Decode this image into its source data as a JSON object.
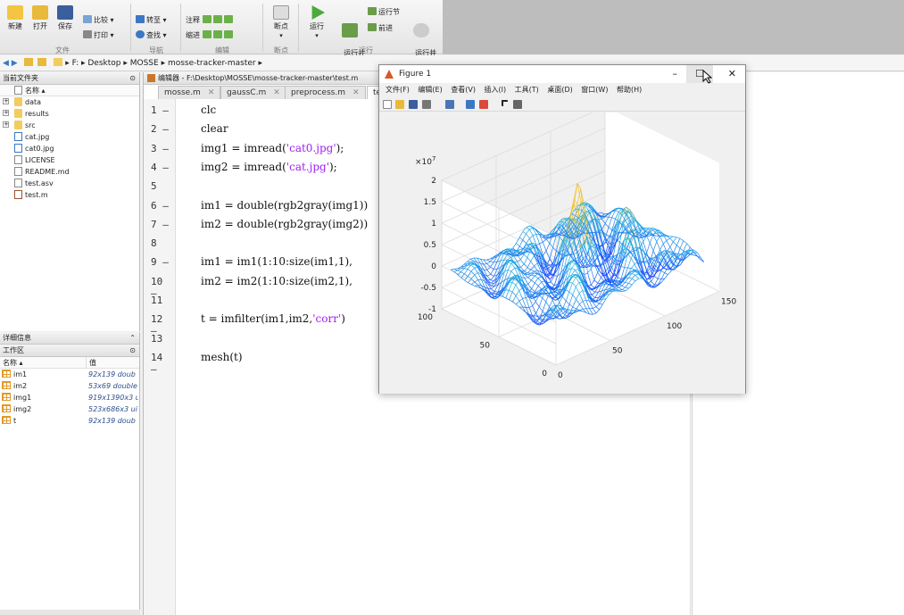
{
  "toolstrip": {
    "buttons": [
      {
        "label": "新建"
      },
      {
        "label": "打开"
      },
      {
        "label": "保存"
      }
    ],
    "file_small": [
      "比较",
      "打印"
    ],
    "nav_small": [
      "转至",
      "查找"
    ],
    "edit_small": [
      "注释",
      "缩进"
    ],
    "breakpoint_label": "断点",
    "run_label": "运行",
    "run_advance_label": "运行并\n前进",
    "run_section_label": "运行节",
    "advance_label": "前进",
    "run_time_label": "运行并\n计时",
    "sections": [
      "文件",
      "导航",
      "编辑",
      "断点",
      "运行"
    ]
  },
  "address": {
    "path": [
      "F:",
      "Desktop",
      "MOSSE",
      "mosse-tracker-master"
    ]
  },
  "current_folder": {
    "title": "当前文件夹",
    "column": "名称 ▴",
    "items": [
      {
        "name": "data",
        "type": "folder"
      },
      {
        "name": "results",
        "type": "folder"
      },
      {
        "name": "src",
        "type": "folder"
      },
      {
        "name": "cat.jpg",
        "type": "img"
      },
      {
        "name": "cat0.jpg",
        "type": "img"
      },
      {
        "name": "LICENSE",
        "type": "file"
      },
      {
        "name": "README.md",
        "type": "file"
      },
      {
        "name": "test.asv",
        "type": "file"
      },
      {
        "name": "test.m",
        "type": "mfile"
      }
    ]
  },
  "details": {
    "title": "详细信息"
  },
  "workspace": {
    "title": "工作区",
    "col_name": "名称 ▴",
    "col_value": "值",
    "vars": [
      {
        "name": "im1",
        "value": "92x139 doub"
      },
      {
        "name": "im2",
        "value": "53x69 double"
      },
      {
        "name": "img1",
        "value": "919x1390x3 u"
      },
      {
        "name": "img2",
        "value": "523x686x3 ui"
      },
      {
        "name": "t",
        "value": "92x139 doub"
      }
    ]
  },
  "editor": {
    "title": "编辑器 - F:\\Desktop\\MOSSE\\mosse-tracker-master\\test.m",
    "tabs": [
      "mosse.m",
      "gaussC.m",
      "preprocess.m",
      "te"
    ],
    "lines": [
      {
        "n": "1",
        "d": "—",
        "code": "clc"
      },
      {
        "n": "2",
        "d": "—",
        "code": "clear"
      },
      {
        "n": "3",
        "d": "—",
        "pre": "img1 = imread(",
        "str": "'cat0.jpg'",
        "post": ");"
      },
      {
        "n": "4",
        "d": "—",
        "pre": "img2 = imread(",
        "str": "'cat.jpg'",
        "post": ");"
      },
      {
        "n": "5",
        "d": "",
        "code": ""
      },
      {
        "n": "6",
        "d": "—",
        "code": "im1 = double(rgb2gray(img1))"
      },
      {
        "n": "7",
        "d": "—",
        "code": "im2 = double(rgb2gray(img2))"
      },
      {
        "n": "8",
        "d": "",
        "code": ""
      },
      {
        "n": "9",
        "d": "—",
        "code": "im1 = im1(1:10:size(im1,1),"
      },
      {
        "n": "10",
        "d": "—",
        "code": "im2 = im2(1:10:size(im2,1),"
      },
      {
        "n": "11",
        "d": "",
        "code": ""
      },
      {
        "n": "12",
        "d": "—",
        "pre": "t = imfilter(im1,im2,",
        "str": "'corr'",
        "post": ")"
      },
      {
        "n": "13",
        "d": "",
        "code": ""
      },
      {
        "n": "14",
        "d": "—",
        "code": "mesh(t)"
      }
    ]
  },
  "figure": {
    "title": "Figure 1",
    "menus": [
      "文件(F)",
      "编辑(E)",
      "查看(V)",
      "插入(I)",
      "工具(T)",
      "桌面(D)",
      "窗口(W)",
      "帮助(H)"
    ],
    "min": "–",
    "max": "☐",
    "close": "✕"
  },
  "chart_data": {
    "type": "surface",
    "zlim": [
      -1,
      2
    ],
    "z_scale": "×10⁷",
    "z_exponent": "7",
    "z_ticks": [
      "2",
      "1.5",
      "1",
      "0.5",
      "0",
      "-0.5",
      "-1"
    ],
    "x_ticks": [
      "0",
      "50",
      "100",
      "150"
    ],
    "y_ticks": [
      "0",
      "50",
      "100"
    ],
    "peak_value": 1.6
  },
  "colors": {
    "surface_low": "#1e3cff",
    "surface_mid": "#22b3e6",
    "surface_high": "#f2c230"
  }
}
